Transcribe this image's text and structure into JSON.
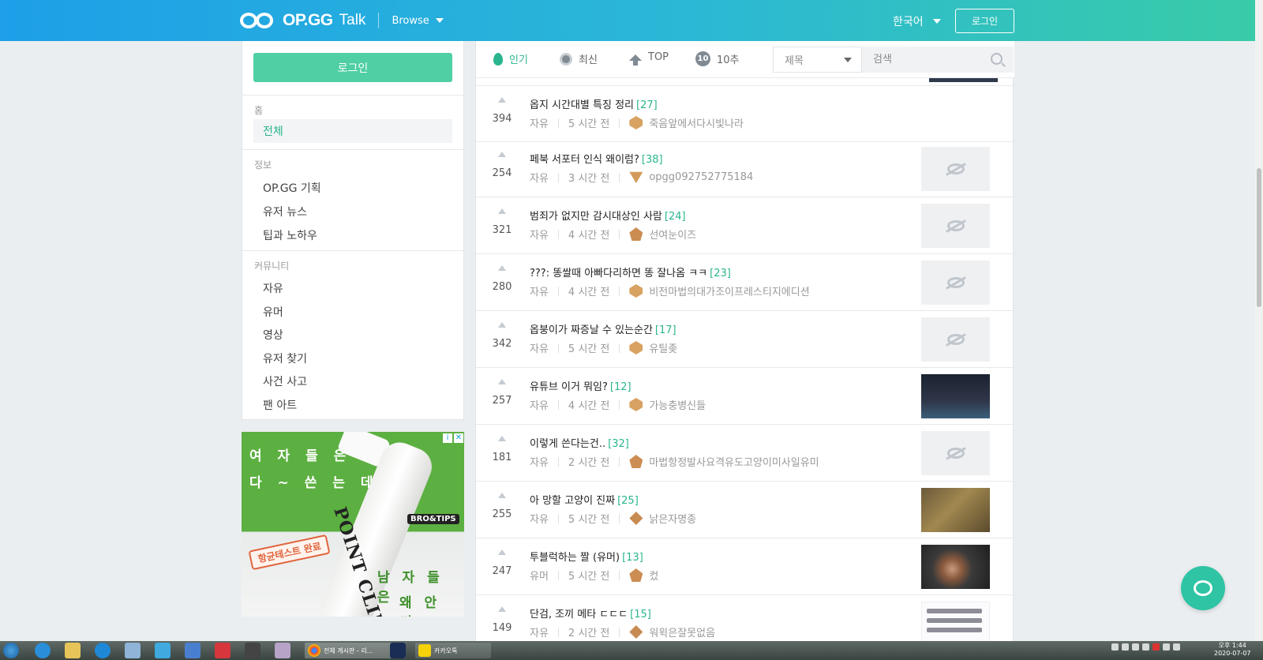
{
  "header": {
    "logo_text": "OP.GG",
    "logo_sub": "Talk",
    "browse_label": "Browse",
    "language": "한국어",
    "login_label": "로그인"
  },
  "sidebar": {
    "login_label": "로그인",
    "sections": [
      {
        "title": "홈",
        "items": [
          "전체"
        ]
      },
      {
        "title": "정보",
        "items": [
          "OP.GG 기획",
          "유저 뉴스",
          "팁과 노하우"
        ]
      },
      {
        "title": "커뮤니티",
        "items": [
          "자유",
          "유머",
          "영상",
          "유저 찾기",
          "사건 사고",
          "팬 아트"
        ]
      }
    ]
  },
  "ad": {
    "line1": "여 자 들 은",
    "line2": "다 ~ 쓴 는 데",
    "badge": "항균테스트 완료",
    "product": "POINT CLINIC",
    "brand": "BRO&TIPS",
    "line3": "남 자 들 은",
    "line4": "왜 안 써 ?"
  },
  "tabs": [
    {
      "label": "인기",
      "icon": "flame-icon",
      "active": true
    },
    {
      "label": "최신",
      "icon": "clock-icon",
      "active": false
    },
    {
      "label": "TOP",
      "icon": "arrow-up-icon",
      "active": false
    },
    {
      "label": "10추",
      "icon": "ten-icon",
      "active": false
    }
  ],
  "search": {
    "select_value": "제목",
    "placeholder": "검색"
  },
  "posts": [
    {
      "votes": "394",
      "title": "옵지 시간대별 특징 정리",
      "comments": "[27]",
      "category": "자유",
      "time": "5 시간 전",
      "author": "죽음앞에서다시빛나라",
      "badge": "gold",
      "thumb": "none"
    },
    {
      "votes": "254",
      "title": "페북 서포터 인식 왜이럼?",
      "comments": "[38]",
      "category": "자유",
      "time": "3 시간 전",
      "author": "opgg092752775184",
      "badge": "tri",
      "thumb": "hidden"
    },
    {
      "votes": "321",
      "title": "범죄가 없지만 감시대상인 사람",
      "comments": "[24]",
      "category": "자유",
      "time": "4 시간 전",
      "author": "선여눈이즈",
      "badge": "pent",
      "thumb": "hidden"
    },
    {
      "votes": "280",
      "title": "???: 똥쌀때 아빠다리하면 똥 잘나옴 ㅋㅋ",
      "comments": "[23]",
      "category": "자유",
      "time": "4 시간 전",
      "author": "비전마법의대가조이프레스티지에디션",
      "badge": "gold",
      "thumb": "hidden"
    },
    {
      "votes": "342",
      "title": "옵붕이가 짜증날 수 있는순간",
      "comments": "[17]",
      "category": "자유",
      "time": "5 시간 전",
      "author": "유틸좆",
      "badge": "gold",
      "thumb": "hidden"
    },
    {
      "votes": "257",
      "title": "유튜브 이거 뭐임?",
      "comments": "[12]",
      "category": "자유",
      "time": "4 시간 전",
      "author": "가능충병신들",
      "badge": "gold",
      "thumb": "dark"
    },
    {
      "votes": "181",
      "title": "이렇게 쓴다는건..",
      "comments": "[32]",
      "category": "자유",
      "time": "2 시간 전",
      "author": "마법항정발사요격유도고양이미사일유미",
      "badge": "pent",
      "thumb": "hidden"
    },
    {
      "votes": "255",
      "title": "아 망할 고양이 진짜",
      "comments": "[25]",
      "category": "자유",
      "time": "5 시간 전",
      "author": "낡은자명종",
      "badge": "dia",
      "thumb": "brown"
    },
    {
      "votes": "247",
      "title": "투블럭하는 짤 (유머)",
      "comments": "[13]",
      "category": "유머",
      "time": "5 시간 전",
      "author": "컸",
      "badge": "pent",
      "thumb": "face"
    },
    {
      "votes": "149",
      "title": "단검, 조끼 메타 ㄷㄷㄷ",
      "comments": "[15]",
      "category": "자유",
      "time": "2 시간 전",
      "author": "워윅은잘못없음",
      "badge": "dia",
      "thumb": "list"
    }
  ],
  "taskbar": {
    "task1": "전체 게시판 - 리...",
    "task2": "카카오톡",
    "clock_time": "오후 1:44",
    "clock_date": "2020-07-07"
  }
}
